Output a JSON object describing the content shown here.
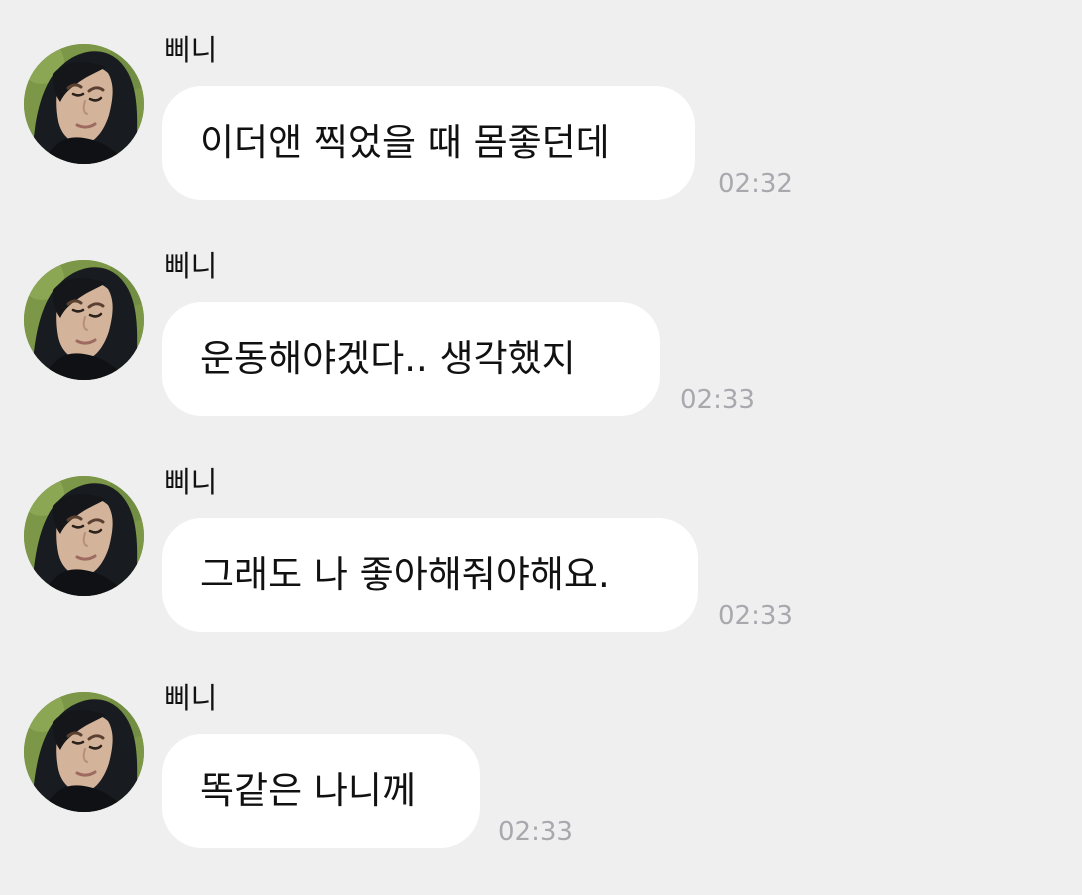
{
  "messages": [
    {
      "sender": "삐니",
      "text": "이더앤 찍었을 때 몸좋던데",
      "time": "02:32"
    },
    {
      "sender": "삐니",
      "text": "운동해야겠다.. 생각했지",
      "time": "02:33"
    },
    {
      "sender": "삐니",
      "text": "그래도 나 좋아해줘야해요.",
      "time": "02:33"
    },
    {
      "sender": "삐니",
      "text": "똑같은 나니께",
      "time": "02:33"
    }
  ],
  "icons": {
    "avatar": "profile-photo"
  },
  "colors": {
    "background": "#efeff0",
    "bubble": "#ffffff",
    "text": "#111111",
    "timestamp": "#a8a8ad"
  }
}
